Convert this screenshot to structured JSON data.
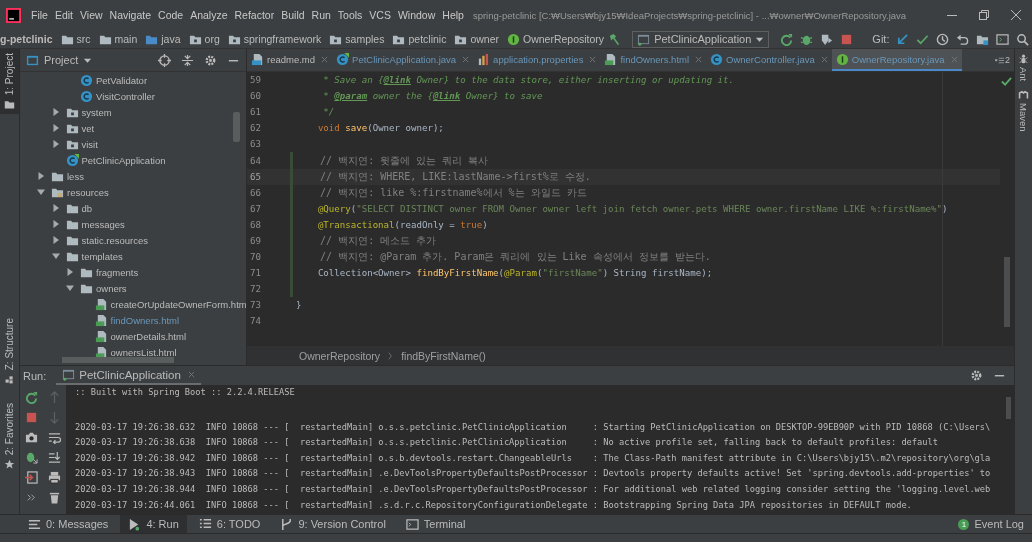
{
  "window": {
    "title": "spring-petclinic [C:₩Users₩bjy15₩IdeaProjects₩spring-petclinic] - ...₩owner₩OwnerRepository.java"
  },
  "menu": [
    "File",
    "Edit",
    "View",
    "Navigate",
    "Code",
    "Analyze",
    "Refactor",
    "Build",
    "Run",
    "Tools",
    "VCS",
    "Window",
    "Help"
  ],
  "breadcrumbs": [
    {
      "label": "g-petclinic",
      "kind": "project"
    },
    {
      "label": "src",
      "kind": "folder"
    },
    {
      "label": "main",
      "kind": "folder"
    },
    {
      "label": "java",
      "kind": "source"
    },
    {
      "label": "org",
      "kind": "package"
    },
    {
      "label": "springframework",
      "kind": "package"
    },
    {
      "label": "samples",
      "kind": "package"
    },
    {
      "label": "petclinic",
      "kind": "package"
    },
    {
      "label": "owner",
      "kind": "package"
    },
    {
      "label": "OwnerRepository",
      "kind": "interface"
    }
  ],
  "run_config": {
    "label": "PetClinicApplication"
  },
  "vcs": {
    "label": "Git:"
  },
  "left_stripe": [
    {
      "label": "1: Project",
      "selected": true
    }
  ],
  "project_panel": {
    "title": "Project",
    "tree": [
      {
        "children": [
          {
            "children": [
              {
                "label": "PetValidator",
                "kind": "class",
                "modified": false
              },
              {
                "label": "VisitController",
                "kind": "class",
                "modified": false
              }
            ]
          },
          {
            "label": "system",
            "kind": "package",
            "expanded": false
          },
          {
            "label": "vet",
            "kind": "package",
            "expanded": false
          },
          {
            "label": "visit",
            "kind": "package",
            "expanded": false
          },
          {
            "label": "PetClinicApplication",
            "kind": "app",
            "modified": false
          }
        ]
      },
      {
        "label": "less",
        "kind": "folder",
        "expanded": false
      },
      {
        "label": "resources",
        "kind": "resources",
        "expanded": true,
        "children": [
          {
            "label": "db",
            "kind": "folder",
            "expanded": false
          },
          {
            "label": "messages",
            "kind": "folder",
            "expanded": false
          },
          {
            "label": "static.resources",
            "kind": "folder",
            "expanded": false
          },
          {
            "label": "templates",
            "kind": "folder",
            "expanded": true,
            "children": [
              {
                "label": "fragments",
                "kind": "folder",
                "expanded": false
              },
              {
                "label": "owners",
                "kind": "folder",
                "expanded": true,
                "children": [
                  {
                    "label": "createOrUpdateOwnerForm.htm",
                    "kind": "html",
                    "modified": false
                  },
                  {
                    "label": "findOwners.html",
                    "kind": "html",
                    "modified": true
                  },
                  {
                    "label": "ownerDetails.html",
                    "kind": "html",
                    "modified": false
                  },
                  {
                    "label": "ownersList.html",
                    "kind": "html",
                    "modified": false
                  }
                ]
              }
            ]
          }
        ]
      }
    ]
  },
  "editor": {
    "tabs": [
      {
        "label": "readme.md",
        "kind": "md",
        "selected": false,
        "modified": false
      },
      {
        "label": "PetClinicApplication.java",
        "kind": "app",
        "selected": false,
        "modified": true
      },
      {
        "label": "application.properties",
        "kind": "properties",
        "selected": false,
        "modified": true
      },
      {
        "label": "findOwners.html",
        "kind": "html",
        "selected": false,
        "modified": true
      },
      {
        "label": "OwnerController.java",
        "kind": "class",
        "selected": false,
        "modified": true
      },
      {
        "label": "OwnerRepository.java",
        "kind": "interface",
        "selected": true,
        "modified": true
      }
    ],
    "hidden_tabs": "2",
    "lines": [
      {
        "number": "59",
        "current": false,
        "changed": false,
        "tokens": [
          {
            "kind": "doc",
            "text": "     * Save an {"
          },
          {
            "kind": "doctag",
            "text": "@link"
          },
          {
            "kind": "doc",
            "text": " Owner} to the data store, either inserting or updating it."
          }
        ]
      },
      {
        "number": "60",
        "current": false,
        "changed": false,
        "tokens": [
          {
            "kind": "doc",
            "text": "     * "
          },
          {
            "kind": "doctag",
            "text": "@param"
          },
          {
            "kind": "doc",
            "text": " owner the {"
          },
          {
            "kind": "doctag",
            "text": "@link"
          },
          {
            "kind": "doc",
            "text": " Owner} to save"
          }
        ]
      },
      {
        "number": "61",
        "current": false,
        "changed": false,
        "tokens": [
          {
            "kind": "doc",
            "text": "     */"
          }
        ]
      },
      {
        "number": "62",
        "current": false,
        "changed": false,
        "tokens": [
          {
            "kind": "keyword",
            "text": "    void "
          },
          {
            "kind": "method",
            "text": "save"
          },
          {
            "kind": "plain",
            "text": "(Owner owner);"
          }
        ]
      },
      {
        "number": "63",
        "current": false,
        "changed": false
      },
      {
        "number": "64",
        "current": false,
        "changed": true,
        "tokens": [
          {
            "kind": "comment",
            "text": "    // 백지연: 윗줄에 있는 쿼리 복사"
          }
        ]
      },
      {
        "number": "65",
        "current": true,
        "changed": true,
        "tokens": [
          {
            "kind": "comment",
            "text": "    // 백지연: WHERE, LIKE:lastName->first%로 수정."
          }
        ]
      },
      {
        "number": "66",
        "current": false,
        "changed": true,
        "tokens": [
          {
            "kind": "comment",
            "text": "    // 백지연: like %:firstname%에서 %는 와일드 카드"
          }
        ]
      },
      {
        "number": "67",
        "current": false,
        "changed": true,
        "tokens": [
          {
            "kind": "annotation",
            "text": "    @Query"
          },
          {
            "kind": "plain",
            "text": "("
          },
          {
            "kind": "string",
            "text": "\"SELECT DISTINCT owner FROM Owner owner left join fetch owner.pets WHERE owner.firstName LIKE %:firstName%\""
          },
          {
            "kind": "plain",
            "text": ")"
          }
        ]
      },
      {
        "number": "68",
        "current": false,
        "changed": true,
        "tokens": [
          {
            "kind": "annotation",
            "text": "    @Transactional"
          },
          {
            "kind": "plain",
            "text": "(readOnly = "
          },
          {
            "kind": "keyword",
            "text": "true"
          },
          {
            "kind": "plain",
            "text": ")"
          }
        ]
      },
      {
        "number": "69",
        "current": false,
        "changed": true,
        "tokens": [
          {
            "kind": "comment",
            "text": "    // 백지연: 메소드 추가"
          }
        ]
      },
      {
        "number": "70",
        "current": false,
        "changed": true,
        "tokens": [
          {
            "kind": "comment",
            "text": "    // 백지연: @Param 추가. Param은 쿼리에 있는 Like 속성에서 정보를 받는다."
          }
        ]
      },
      {
        "number": "71",
        "current": false,
        "changed": true,
        "tokens": [
          {
            "kind": "plain",
            "text": "    Collection<Owner> "
          },
          {
            "kind": "method",
            "text": "findByFirstName"
          },
          {
            "kind": "plain",
            "text": "("
          },
          {
            "kind": "annotation",
            "text": "@Param"
          },
          {
            "kind": "plain",
            "text": "("
          },
          {
            "kind": "string",
            "text": "\"firstName\""
          },
          {
            "kind": "plain",
            "text": ") String firstName);"
          }
        ]
      },
      {
        "number": "72",
        "current": false,
        "changed": true
      },
      {
        "number": "73",
        "current": false,
        "changed": false,
        "tokens": [
          {
            "kind": "plain",
            "text": "}"
          }
        ]
      },
      {
        "number": "74",
        "current": false,
        "changed": false
      }
    ],
    "breadcrumbs": [
      "OwnerRepository",
      "findByFirstName()"
    ]
  },
  "right_stripe": [
    {
      "label": "Ant",
      "kind": "ant"
    },
    {
      "label": "Maven",
      "kind": "maven"
    }
  ],
  "run_side": [
    {
      "label": "Z: Structure",
      "kind": "structure"
    },
    {
      "label": "2: Favorites",
      "kind": "favorites"
    }
  ],
  "run_panel": {
    "label": "Run:",
    "tab": "PetClinicApplication",
    "console": [
      ":: Built with Spring Boot :: 2.2.4.RELEASE",
      "2020-03-17 19:26:38.632  INFO 10868 --- [  restartedMain] o.s.s.petclinic.PetClinicApplication     : Starting PetClinicApplication on DESKTOP-99EB90P with PID 10868 (C:\\Users\\",
      "2020-03-17 19:26:38.638  INFO 10868 --- [  restartedMain] o.s.s.petclinic.PetClinicApplication     : No active profile set, falling back to default profiles: default",
      "2020-03-17 19:26:38.942  INFO 10868 --- [  restartedMain] o.s.b.devtools.restart.ChangeableUrls    : The Class-Path manifest attribute in C:\\Users\\bjy15\\.m2\\repository\\org\\gla",
      "2020-03-17 19:26:38.943  INFO 10868 --- [  restartedMain] .e.DevToolsPropertyDefaultsPostProcessor : Devtools property defaults active! Set 'spring.devtools.add-properties' to",
      "2020-03-17 19:26:38.944  INFO 10868 --- [  restartedMain] .e.DevToolsPropertyDefaultsPostProcessor : For additional web related logging consider setting the 'logging.level.web",
      "2020-03-17 19:26:44.061  INFO 10868 --- [  restartedMain] .s.d.r.c.RepositoryConfigurationDelegate : Bootstrapping Spring Data JPA repositories in DEFAULT mode."
    ]
  },
  "bottom_tabs": [
    {
      "label": "0: Messages",
      "kind": "messages",
      "selected": false
    },
    {
      "label": "4: Run",
      "kind": "run",
      "selected": true
    },
    {
      "label": "6: TODO",
      "kind": "todo",
      "selected": false
    },
    {
      "label": "9: Version Control",
      "kind": "vcs",
      "selected": false
    },
    {
      "label": "Terminal",
      "kind": "terminal",
      "selected": false
    }
  ],
  "event_log": {
    "label": "Event Log",
    "badge": "1"
  }
}
